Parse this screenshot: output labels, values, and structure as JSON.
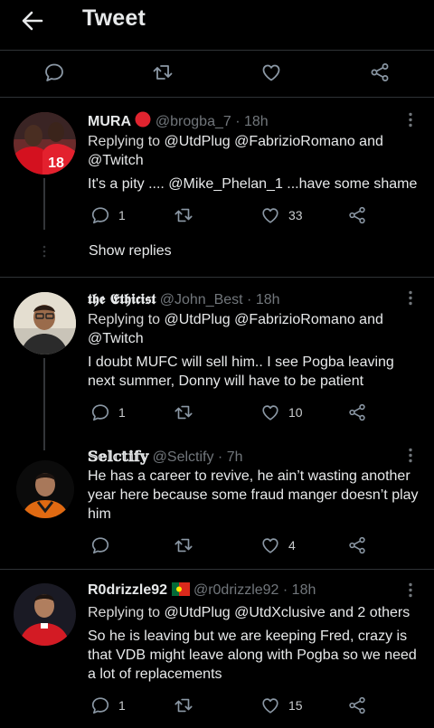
{
  "header": {
    "title": "Tweet",
    "back_icon": "arrow-left-icon"
  },
  "actionbar": {
    "icons": [
      "reply-icon",
      "retweet-icon",
      "like-icon",
      "share-icon"
    ]
  },
  "colors": {
    "background": "#000000",
    "text": "#e7e9ea",
    "muted": "#71767b",
    "separator": "#2f3336"
  },
  "replies": [
    {
      "name": "MURA",
      "badge": "red-circle",
      "handle": "@brogba_7",
      "time": "18h",
      "replying_prefix": "Replying to",
      "replying_to": "@UtdPlug @FabrizioRomano and",
      "replying_to_2": "@Twitch",
      "text": "It's a pity .... @Mike_Phelan_1 ...have some shame",
      "reply_count": "1",
      "retweet_count": "",
      "like_count": "33",
      "show_replies": "Show replies"
    },
    {
      "name": "𝖙𝖍𝖊 𝕰𝖙𝖍𝖎𝖈𝖎𝖘𝖙",
      "handle": "@John_Best",
      "time": "18h",
      "replying_prefix": "Replying to",
      "replying_to": "@UtdPlug @FabrizioRomano and",
      "replying_to_2": "@Twitch",
      "text": "I doubt MUFC will sell him.. I see Pogba leaving next summer, Donny will have to be patient",
      "reply_count": "1",
      "retweet_count": "",
      "like_count": "10"
    },
    {
      "name": "𝕊𝕖𝕝𝕔𝕥𝕚𝕗𝕪",
      "handle": "@Selctify",
      "time": "7h",
      "text": "He has a career to revive, he ain’t wasting another year here because some fraud manger doesn’t play him",
      "reply_count": "",
      "retweet_count": "",
      "like_count": "4"
    },
    {
      "name": "R0drizzle92",
      "flag": "portugal-flag",
      "handle": "@r0drizzle92",
      "time": "18h",
      "replying_prefix": "Replying to",
      "replying_to": "@UtdPlug @UtdXclusive and 2 others",
      "text": "So he is leaving but we are keeping Fred, crazy is that VDB might leave along with Pogba so we need a lot of replacements",
      "reply_count": "1",
      "retweet_count": "",
      "like_count": "15"
    }
  ]
}
